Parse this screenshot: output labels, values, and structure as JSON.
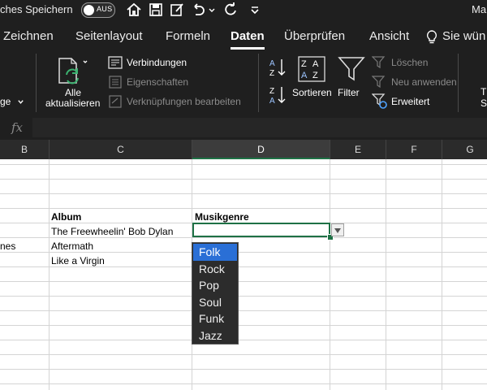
{
  "titlebar": {
    "autosave_label": "ches Speichern",
    "toggle_label": "AUS",
    "doc_title": "Ma"
  },
  "tabs": [
    {
      "label": "Zeichnen"
    },
    {
      "label": "Seitenlayout"
    },
    {
      "label": "Formeln"
    },
    {
      "label": "Daten",
      "active": true
    },
    {
      "label": "Überprüfen"
    },
    {
      "label": "Ansicht"
    },
    {
      "label": "Sie wün"
    }
  ],
  "ribbon": {
    "left_cut": "ge",
    "refresh_label_1": "Alle",
    "refresh_label_2": "aktualisieren",
    "connections": "Verbindungen",
    "properties": "Eigenschaften",
    "edit_links": "Verknüpfungen bearbeiten",
    "sort": "Sortieren",
    "filter": "Filter",
    "clear": "Löschen",
    "reapply": "Neu anwenden",
    "advanced": "Erweitert",
    "right_cut_1": "T",
    "right_cut_2": "S"
  },
  "formula_bar": {
    "fx": "fx",
    "value": ""
  },
  "columns": [
    "B",
    "C",
    "D",
    "E",
    "F",
    "G"
  ],
  "cells": {
    "header_album": "Album",
    "header_genre": "Musikgenre",
    "row1_album": "The Freewheelin' Bob Dylan",
    "row2_b": "nes",
    "row2_album": "Aftermath",
    "row3_album": "Like a Virgin"
  },
  "dropdown": {
    "options": [
      "Folk",
      "Rock",
      "Pop",
      "Soul",
      "Funk",
      "Jazz"
    ],
    "selected": "Folk"
  },
  "colors": {
    "accent_green": "#1e7145",
    "selection_blue": "#2a6fd6"
  }
}
